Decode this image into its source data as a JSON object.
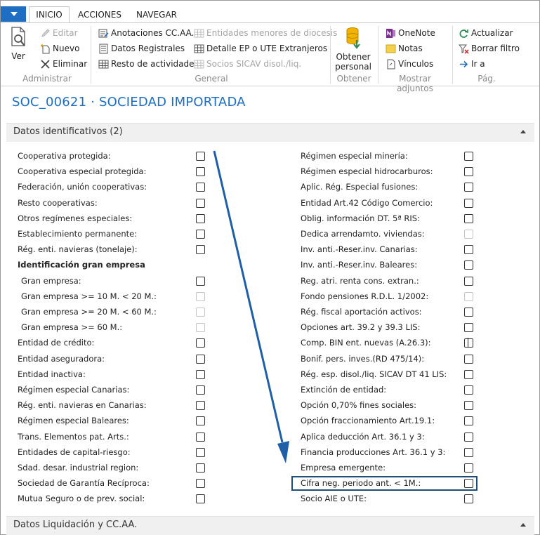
{
  "tabs": [
    {
      "label": "INICIO",
      "active": true
    },
    {
      "label": "ACCIONES",
      "active": false
    },
    {
      "label": "NAVEGAR",
      "active": false
    }
  ],
  "ribbon": {
    "administrar": {
      "label": "Administrar",
      "ver": "Ver",
      "editar": "Editar",
      "nuevo": "Nuevo",
      "eliminar": "Eliminar"
    },
    "general": {
      "label": "General",
      "anotaciones": "Anotaciones CC.AA.",
      "datos_registrales": "Datos Registrales",
      "resto_actividades": "Resto de actividades",
      "entidades_menores": "Entidades menores de diocesis",
      "detalle_ep": "Detalle EP o UTE Extranjeros",
      "socios_sicav": "Socios SICAV disol./liq."
    },
    "obtener": {
      "label": "Obtener",
      "line1": "Obtener",
      "line2": "personal"
    },
    "adjuntos": {
      "label": "Mostrar adjuntos",
      "onenote": "OneNote",
      "notas": "Notas",
      "vinculos": "Vínculos"
    },
    "pag": {
      "label": "Pág.",
      "actualizar": "Actualizar",
      "borrar_filtro": "Borrar filtro",
      "ir_a": "Ir a"
    }
  },
  "page_title": "SOC_00621 · SOCIEDAD IMPORTADA",
  "sections": {
    "identificativos": "Datos identificativos (2)",
    "liquidacion": "Datos Liquidación y CC.AA."
  },
  "left_fields": [
    {
      "label": "Cooperativa protegida:",
      "checkbox": true,
      "disabled": false
    },
    {
      "label": "Cooperativa especial protegida:",
      "checkbox": true,
      "disabled": false
    },
    {
      "label": "Federación, unión cooperativas:",
      "checkbox": true,
      "disabled": false
    },
    {
      "label": "Resto cooperativas:",
      "checkbox": true,
      "disabled": false
    },
    {
      "label": "Otros regímenes especiales:",
      "checkbox": true,
      "disabled": false
    },
    {
      "label": "Establecimiento permanente:",
      "checkbox": true,
      "disabled": false
    },
    {
      "label": "Rég. enti. navieras (tonelaje):",
      "checkbox": true,
      "disabled": false
    },
    {
      "label": "Identificación gran empresa",
      "checkbox": false,
      "bold": true
    },
    {
      "label": "Gran empresa:",
      "checkbox": true,
      "disabled": false,
      "sub": true
    },
    {
      "label": "Gran empresa >= 10 M. < 20 M.:",
      "checkbox": true,
      "disabled": true,
      "sub": true
    },
    {
      "label": "Gran empresa >= 20 M. < 60 M.:",
      "checkbox": true,
      "disabled": true,
      "sub": true
    },
    {
      "label": "Gran empresa >= 60 M.:",
      "checkbox": true,
      "disabled": true,
      "sub": true
    },
    {
      "label": "Entidad de crédito:",
      "checkbox": true,
      "disabled": false
    },
    {
      "label": "Entidad aseguradora:",
      "checkbox": true,
      "disabled": false
    },
    {
      "label": "Entidad inactiva:",
      "checkbox": true,
      "disabled": false
    },
    {
      "label": "Régimen especial Canarias:",
      "checkbox": true,
      "disabled": false
    },
    {
      "label": "Rég. enti. navieras en Canarias:",
      "checkbox": true,
      "disabled": false
    },
    {
      "label": "Régimen especial Baleares:",
      "checkbox": true,
      "disabled": false
    },
    {
      "label": "Trans. Elementos pat. Arts.:",
      "checkbox": true,
      "disabled": false
    },
    {
      "label": "Entidades de capital-riesgo:",
      "checkbox": true,
      "disabled": false
    },
    {
      "label": "Sdad. desar. industrial region:",
      "checkbox": true,
      "disabled": false
    },
    {
      "label": "Sociedad de Garantía Recíproca:",
      "checkbox": true,
      "disabled": false
    },
    {
      "label": "Mutua Seguro o de prev. social:",
      "checkbox": true,
      "disabled": false
    }
  ],
  "right_fields": [
    {
      "label": "Régimen especial minería:",
      "disabled": false
    },
    {
      "label": "Régimen especial hidrocarburos:",
      "disabled": false
    },
    {
      "label": "Aplic. Rég. Especial fusiones:",
      "disabled": false
    },
    {
      "label": "Entidad Art.42 Código Comercio:",
      "disabled": false
    },
    {
      "label": "Oblig. información DT. 5ª RIS:",
      "disabled": false
    },
    {
      "label": "Dedica arrendamto. viviendas:",
      "disabled": true
    },
    {
      "label": "Inv. anti.-Reser.inv. Canarias:",
      "disabled": false
    },
    {
      "label": "Inv. anti.-Reser.inv. Baleares:",
      "disabled": false
    },
    {
      "label": "Reg. atri. renta cons. extran.:",
      "disabled": false
    },
    {
      "label": "Fondo pensiones R.D.L. 1/2002:",
      "disabled": true
    },
    {
      "label": "Rég. fiscal aportación activos:",
      "disabled": false
    },
    {
      "label": "Opciones art. 39.2 y 39.3 LIS:",
      "disabled": false
    },
    {
      "label": "Comp. BIN ent. nuevas (A.26.3):",
      "disabled": false
    },
    {
      "label": "Bonif. pers. inves.(RD 475/14):",
      "disabled": false
    },
    {
      "label": "Rég. esp. disol./liq. SICAV DT 41 LIS:",
      "disabled": false
    },
    {
      "label": "Extinción de entidad:",
      "disabled": false
    },
    {
      "label": "Opción 0,70% fines sociales:",
      "disabled": false
    },
    {
      "label": "Opción fraccionamiento Art.19.1:",
      "disabled": false
    },
    {
      "label": "Aplica deducción Art. 36.1 y 3:",
      "disabled": false
    },
    {
      "label": "Financia producciones Art. 36.1 y 3:",
      "disabled": false
    },
    {
      "label": "Empresa emergente:",
      "disabled": false
    },
    {
      "label": "Cifra neg. periodo ant. < 1M.:",
      "disabled": false,
      "highlighted": true
    },
    {
      "label": "Socio AIE o UTE:",
      "disabled": false
    }
  ],
  "colors": {
    "accent": "#1e6fc4",
    "highlight_border": "#1f4e79",
    "arrow": "#1e5fa8"
  }
}
